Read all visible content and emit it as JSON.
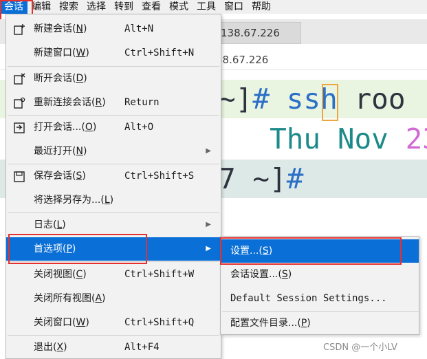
{
  "menubar": {
    "items": [
      "会话",
      "编辑",
      "搜索",
      "选择",
      "转到",
      "查看",
      "模式",
      "工具",
      "窗口",
      "帮助"
    ]
  },
  "background": {
    "tab_title": "138.67.226",
    "address_text": "38.67.226",
    "terminal": {
      "line1": {
        "a": "~]",
        "b": "#",
        "c": "ssh",
        "d": "roo"
      },
      "line2": {
        "a": "Thu",
        "b": "Nov",
        "c": "23"
      },
      "line3": {
        "a": "7 ~]",
        "b": "#"
      }
    }
  },
  "session_menu": {
    "items": [
      {
        "label": "新建会话(",
        "mn": "N",
        "end": ")",
        "shortcut": "Alt+N",
        "icon": "new-session-icon"
      },
      {
        "label": "新建窗口(",
        "mn": "W",
        "end": ")",
        "shortcut": "Ctrl+Shift+N"
      },
      {
        "label": "断开会话(",
        "mn": "D",
        "end": ")",
        "shortcut": "",
        "icon": "disconnect-icon"
      },
      {
        "label": "重新连接会话(",
        "mn": "R",
        "end": ")",
        "shortcut": "Return",
        "icon": "reconnect-icon"
      },
      {
        "label": "打开会话...(",
        "mn": "O",
        "end": ")",
        "shortcut": "Alt+O",
        "icon": "open-session-icon"
      },
      {
        "label": "最近打开(",
        "mn": "N",
        "end": ")",
        "shortcut": ""
      },
      {
        "label": "保存会话(",
        "mn": "S",
        "end": ")",
        "shortcut": "Ctrl+Shift+S",
        "icon": "save-icon"
      },
      {
        "label": "将选择另存为...(",
        "mn": "L",
        "end": ")",
        "shortcut": ""
      },
      {
        "label": "日志(",
        "mn": "L",
        "end": ")",
        "shortcut": ""
      },
      {
        "label": "首选项(",
        "mn": "P",
        "end": ")",
        "shortcut": ""
      },
      {
        "label": "关闭视图(",
        "mn": "C",
        "end": ")",
        "shortcut": "Ctrl+Shift+W"
      },
      {
        "label": "关闭所有视图(",
        "mn": "A",
        "end": ")",
        "shortcut": ""
      },
      {
        "label": "关闭窗口(",
        "mn": "W",
        "end": ")",
        "shortcut": "Ctrl+Shift+Q"
      },
      {
        "label": "退出(",
        "mn": "X",
        "end": ")",
        "shortcut": "Alt+F4"
      }
    ]
  },
  "preferences_submenu": {
    "items": [
      {
        "label": "设置...(",
        "mn": "S",
        "end": ")"
      },
      {
        "label": "会话设置...(",
        "mn": "S",
        "end": ")"
      },
      {
        "label": "Default Session Settings..."
      },
      {
        "label": "配置文件目录...(",
        "mn": "P",
        "end": ")"
      }
    ]
  },
  "colors": {
    "highlight": "#0a6fd6",
    "annotation": "#e53030",
    "cursor": "#f0a640"
  },
  "watermark": "CSDN @一个小LV"
}
